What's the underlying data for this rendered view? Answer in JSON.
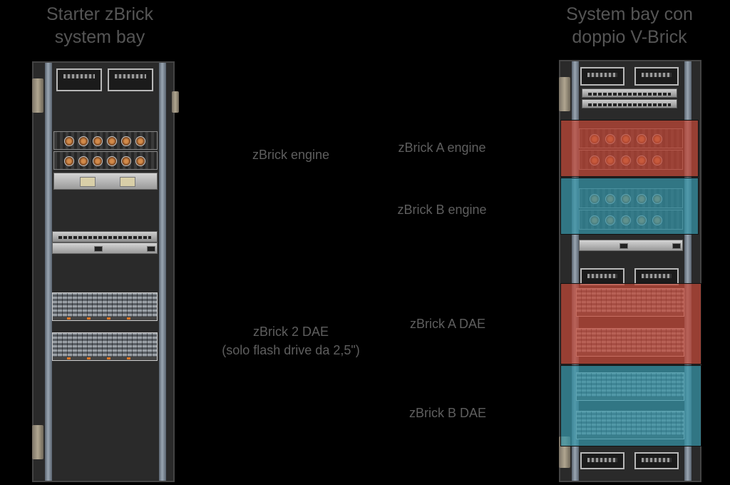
{
  "left_rack": {
    "title": "Starter zBrick\nsystem bay"
  },
  "right_rack": {
    "title": "System bay con\ndoppio V-Brick"
  },
  "labels": {
    "left_engine": "zBrick engine",
    "left_dae": "zBrick 2 DAE\n(solo flash drive da 2,5\")",
    "a_engine": "zBrick A engine",
    "b_engine": "zBrick B engine",
    "a_dae": "zBrick A DAE",
    "b_dae": "zBrick B DAE"
  },
  "highlight_colors": {
    "zbrick_a": "#c44838",
    "zbrick_b": "#3494a8"
  }
}
